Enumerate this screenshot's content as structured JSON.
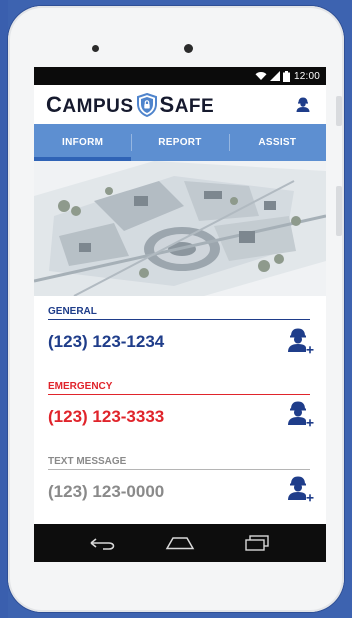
{
  "status": {
    "time": "12:00"
  },
  "app": {
    "logo_left": "CAMPUS",
    "logo_right": "SAFE"
  },
  "tabs": [
    {
      "label": "INFORM",
      "active": true
    },
    {
      "label": "REPORT",
      "active": false
    },
    {
      "label": "ASSIST",
      "active": false
    }
  ],
  "contacts": [
    {
      "label": "GENERAL",
      "number": "(123) 123-1234",
      "label_color": "#1f3d8a",
      "number_color": "#1f3d8a",
      "line_color": "#1f3d8a"
    },
    {
      "label": "EMERGENCY",
      "number": "(123) 123-3333",
      "label_color": "#e0242b",
      "number_color": "#e0242b",
      "line_color": "#e0242b"
    },
    {
      "label": "TEXT MESSAGE",
      "number": "(123) 123-0000",
      "label_color": "#8a8a8a",
      "number_color": "#8a8a8a",
      "line_color": "#b5b5b5"
    }
  ],
  "icons": {
    "status": [
      "wifi-icon",
      "signal-icon",
      "battery-icon"
    ],
    "profile": "user-icon",
    "add_contact": "add-contact-icon",
    "nav": [
      "back-icon",
      "home-icon",
      "recent-apps-icon"
    ]
  },
  "colors": {
    "tab_bg": "#5d8fd1",
    "tab_active": "#2f63b6",
    "brand": "#161a2e"
  }
}
